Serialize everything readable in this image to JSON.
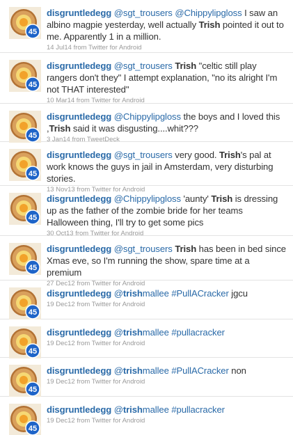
{
  "avatar": {
    "icon": "pie-45-avatar-icon",
    "badge": "45",
    "colors": {
      "crust": "#d9a05c",
      "crust_dark": "#b27235",
      "filling": "#f6d874",
      "yolk": "#f2a22a",
      "badge": "#1e64c8"
    }
  },
  "colors": {
    "link": "#2a6aa8",
    "meta": "#9a9a9a",
    "text": "#333333",
    "divider": "#e3e3e3"
  },
  "tweets": [
    {
      "user": "disgruntledegg",
      "parts": [
        {
          "t": "mention",
          "v": "@sgt_trousers"
        },
        {
          "t": "text",
          "v": " "
        },
        {
          "t": "mention",
          "v": "@Chippylipgloss"
        },
        {
          "t": "text",
          "v": " I saw an albino magpie yesterday, well actually "
        },
        {
          "t": "kw",
          "v": "Trish"
        },
        {
          "t": "text",
          "v": " pointed it out to me. Apparently 1 in a million."
        }
      ],
      "time": "14 Jul14",
      "source_prefix": "from",
      "source": "Twitter for Android"
    },
    {
      "user": "disgruntledegg",
      "parts": [
        {
          "t": "mention",
          "v": "@sgt_trousers"
        },
        {
          "t": "text",
          "v": " "
        },
        {
          "t": "kw",
          "v": "Trish"
        },
        {
          "t": "text",
          "v": " \"celtic still play rangers don't they\" I attempt explanation, \"no its alright I'm not THAT interested\""
        }
      ],
      "time": "10 Mar14",
      "source_prefix": "from",
      "source": "Twitter for Android"
    },
    {
      "user": "disgruntledegg",
      "parts": [
        {
          "t": "mention",
          "v": "@Chippylipgloss"
        },
        {
          "t": "text",
          "v": " the boys and I loved this ,"
        },
        {
          "t": "kw",
          "v": "Trish"
        },
        {
          "t": "text",
          "v": " said it was disgusting....whit???"
        }
      ],
      "time": "3 Jan14",
      "source_prefix": "from",
      "source": "TweetDeck"
    },
    {
      "user": "disgruntledegg",
      "parts": [
        {
          "t": "mention",
          "v": "@sgt_trousers"
        },
        {
          "t": "text",
          "v": " very good. "
        },
        {
          "t": "kw",
          "v": "Trish"
        },
        {
          "t": "text",
          "v": "'s pal at work knows the guys in jail in Amsterdam, very disturbing stories."
        }
      ],
      "time": "13 Nov13",
      "source_prefix": "from",
      "source": "Twitter for Android"
    },
    {
      "user": "disgruntledegg",
      "parts": [
        {
          "t": "mention",
          "v": "@Chippylipgloss"
        },
        {
          "t": "text",
          "v": " 'aunty' "
        },
        {
          "t": "kw",
          "v": "Trish"
        },
        {
          "t": "text",
          "v": " is dressing up as the father of the zombie bride for her teams Halloween thing, I'll try to get some pics"
        }
      ],
      "time": "30 Oct13",
      "source_prefix": "from",
      "source": "Twitter for Android"
    },
    {
      "user": "disgruntledegg",
      "parts": [
        {
          "t": "mention",
          "v": "@sgt_trousers"
        },
        {
          "t": "text",
          "v": " "
        },
        {
          "t": "kw",
          "v": "Trish"
        },
        {
          "t": "text",
          "v": " has been in bed since Xmas eve, so I'm running the show, spare time at a premium"
        }
      ],
      "time": "27 Dec12",
      "source_prefix": "from",
      "source": "Twitter for Android"
    },
    {
      "user": "disgruntledegg",
      "parts": [
        {
          "t": "mention",
          "v": "@"
        },
        {
          "t": "kwlink",
          "v": "trish"
        },
        {
          "t": "mention",
          "v": "mallee"
        },
        {
          "t": "text",
          "v": " "
        },
        {
          "t": "hashtag",
          "v": "#PullACracker"
        },
        {
          "t": "text",
          "v": " jgcu"
        }
      ],
      "time": "19 Dec12",
      "source_prefix": "from",
      "source": "Twitter for Android"
    },
    {
      "user": "disgruntledegg",
      "parts": [
        {
          "t": "mention",
          "v": "@"
        },
        {
          "t": "kwlink",
          "v": "trish"
        },
        {
          "t": "mention",
          "v": "mallee"
        },
        {
          "t": "text",
          "v": " "
        },
        {
          "t": "hashtag",
          "v": "#pullacracker"
        }
      ],
      "time": "19 Dec12",
      "source_prefix": "from",
      "source": "Twitter for Android"
    },
    {
      "user": "disgruntledegg",
      "parts": [
        {
          "t": "mention",
          "v": "@"
        },
        {
          "t": "kwlink",
          "v": "trish"
        },
        {
          "t": "mention",
          "v": "mallee"
        },
        {
          "t": "text",
          "v": " "
        },
        {
          "t": "hashtag",
          "v": "#PullACracker"
        },
        {
          "t": "text",
          "v": " non"
        }
      ],
      "time": "19 Dec12",
      "source_prefix": "from",
      "source": "Twitter for Android"
    },
    {
      "user": "disgruntledegg",
      "parts": [
        {
          "t": "mention",
          "v": "@"
        },
        {
          "t": "kwlink",
          "v": "trish"
        },
        {
          "t": "mention",
          "v": "mallee"
        },
        {
          "t": "text",
          "v": " "
        },
        {
          "t": "hashtag",
          "v": "#pullacracker"
        }
      ],
      "time": "19 Dec12",
      "source_prefix": "from",
      "source": "Twitter for Android"
    }
  ]
}
